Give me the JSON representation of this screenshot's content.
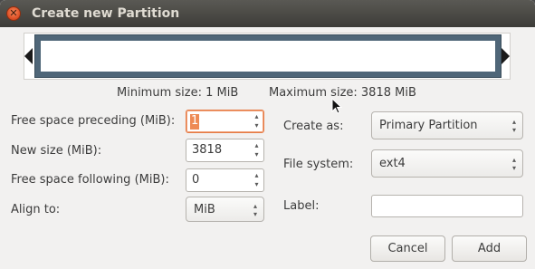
{
  "window": {
    "title": "Create new Partition",
    "close_glyph": "✕"
  },
  "size_info": {
    "minimum": "Minimum size: 1 MiB",
    "maximum": "Maximum size: 3818 MiB"
  },
  "left_form": {
    "free_preceding": {
      "label": "Free space preceding (MiB):",
      "value": "1"
    },
    "new_size": {
      "label": "New size (MiB):",
      "value": "3818"
    },
    "free_following": {
      "label": "Free space following (MiB):",
      "value": "0"
    },
    "align_to": {
      "label": "Align to:",
      "value": "MiB"
    }
  },
  "right_form": {
    "create_as": {
      "label": "Create as:",
      "value": "Primary Partition"
    },
    "file_system": {
      "label": "File system:",
      "value": "ext4"
    },
    "partition_label": {
      "label": "Label:",
      "value": ""
    }
  },
  "buttons": {
    "cancel": "Cancel",
    "add": "Add"
  },
  "icons": {
    "close": "close-icon",
    "spin_up": "▴",
    "spin_down": "▾"
  },
  "colors": {
    "accent": "#e57a44",
    "partition_bar": "#4f6678",
    "titlebar": "#3d3c38"
  }
}
